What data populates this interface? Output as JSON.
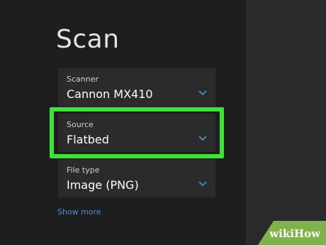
{
  "page": {
    "title": "Scan"
  },
  "fields": {
    "scanner": {
      "label": "Scanner",
      "value": "Cannon MX410"
    },
    "source": {
      "label": "Source",
      "value": "Flatbed"
    },
    "file_type": {
      "label": "File type",
      "value": "Image (PNG)"
    }
  },
  "links": {
    "show_more": "Show more"
  },
  "watermark": {
    "wiki": "wiki",
    "how": "How"
  },
  "icons": {
    "dropdown": "chevron-down-icon"
  },
  "colors": {
    "background": "#1e1e1e",
    "panel": "#2b2b2b",
    "side_panel": "#2a2a2a",
    "accent_link": "#4f90c9",
    "highlight": "#3de23a",
    "watermark_bg": "#7fb24a"
  }
}
